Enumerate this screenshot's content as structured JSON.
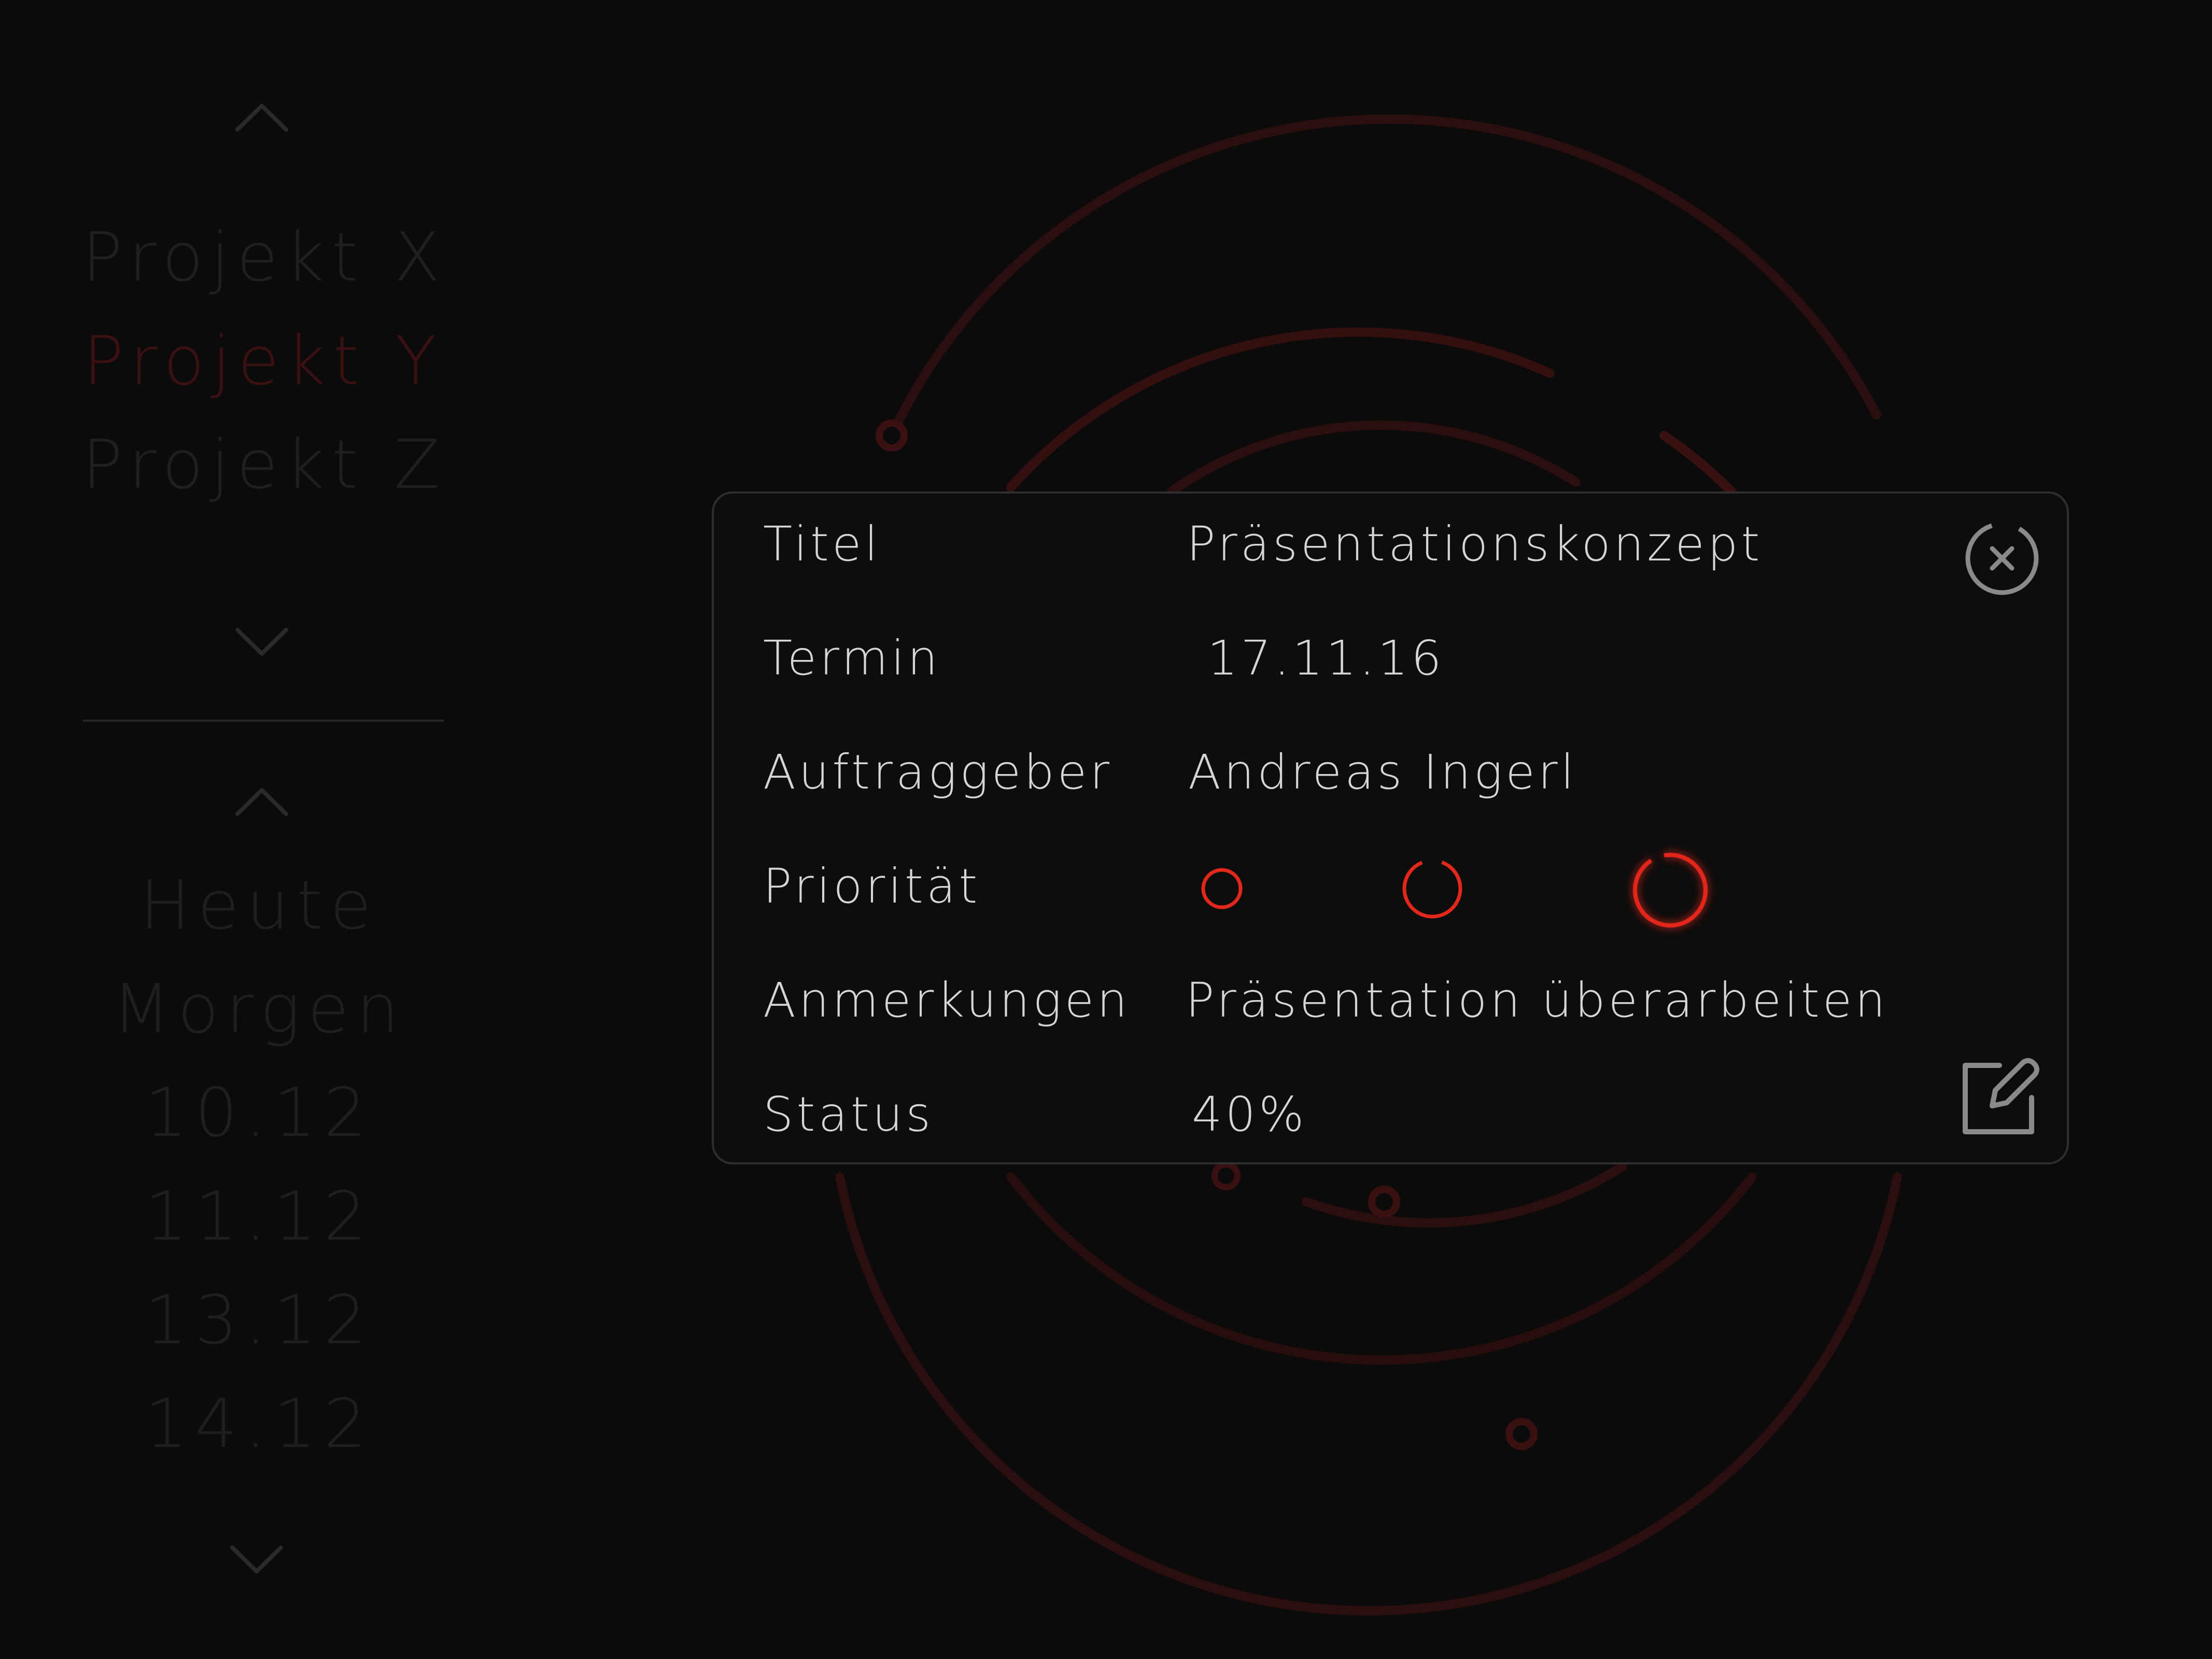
{
  "colors": {
    "background": "#0b0b0b",
    "accent": "#e2281a",
    "accent_dim": "#3a1010",
    "text": "#d6d6d6",
    "muted": "#2a2a2a"
  },
  "sidebar": {
    "projects": [
      {
        "label": "Projekt X",
        "active": false
      },
      {
        "label": "Projekt Y",
        "active": true
      },
      {
        "label": "Projekt Z",
        "active": false
      }
    ],
    "dates": [
      "Heute",
      "Morgen",
      "10.12",
      "11.12",
      "13.12",
      "14.12"
    ],
    "icons": {
      "scroll_up": "chevron-up-icon",
      "scroll_down": "chevron-down-icon"
    }
  },
  "detail": {
    "rows": [
      {
        "label": "Titel",
        "value": "Präsentationskonzept"
      },
      {
        "label": "Termin",
        "value": "17.11.16"
      },
      {
        "label": "Auftraggeber",
        "value": "Andreas Ingerl"
      },
      {
        "label": "Priorität",
        "value": ""
      },
      {
        "label": "Anmerkungen",
        "value": "Präsentation überarbeiten"
      },
      {
        "label": "Status",
        "value": "40%"
      }
    ],
    "priority_levels": 3,
    "priority_selected": 3,
    "icons": {
      "close": "close-icon",
      "edit": "edit-icon"
    }
  }
}
